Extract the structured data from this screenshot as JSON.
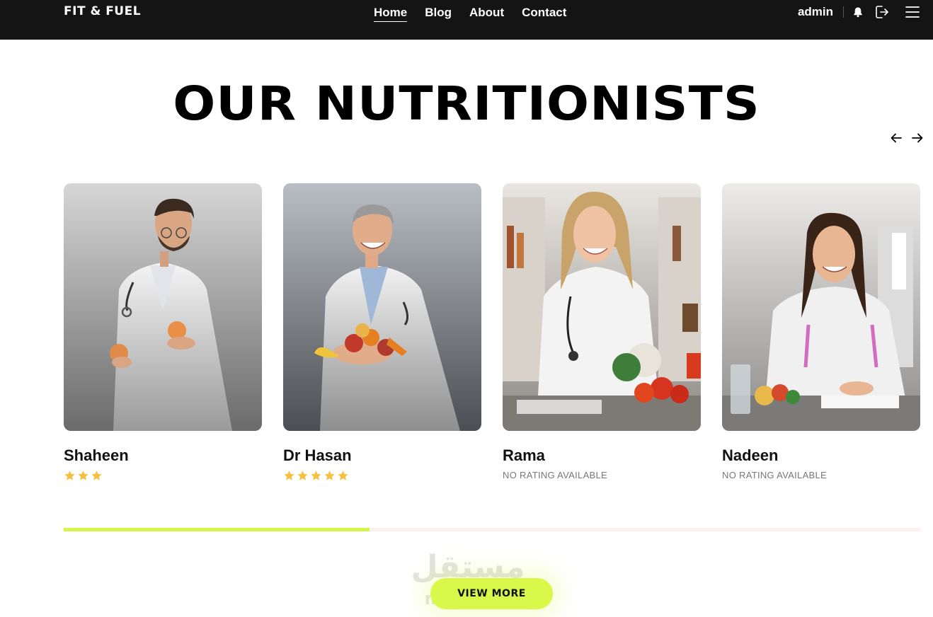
{
  "nav": {
    "logo": "FIT & FUEL",
    "links": [
      "Home",
      "Blog",
      "About",
      "Contact"
    ],
    "active_link": "Home",
    "username": "admin",
    "icons": [
      "bell-icon",
      "logout-icon",
      "menu-icon"
    ]
  },
  "section": {
    "title": "OUR NUTRITIONISTS",
    "prev_icon": "arrow-left-icon",
    "next_icon": "arrow-right-icon"
  },
  "nutritionists": [
    {
      "name": "Shaheen",
      "rating": 3,
      "rating_text": ""
    },
    {
      "name": "Dr Hasan",
      "rating": 5,
      "rating_text": ""
    },
    {
      "name": "Rama",
      "rating": 0,
      "rating_text": "NO RATING AVAILABLE"
    },
    {
      "name": "Nadeen",
      "rating": 0,
      "rating_text": "NO RATING AVAILABLE"
    }
  ],
  "carousel_progress": 0.357,
  "view_more_label": "VIEW MORE",
  "watermark": {
    "arabic": "مستقل",
    "latin": "mostaql"
  },
  "colors": {
    "nav_bg": "#141414",
    "accent": "#d9f84a",
    "progress_track": "#fdf1ee",
    "star": "#f6c143"
  }
}
